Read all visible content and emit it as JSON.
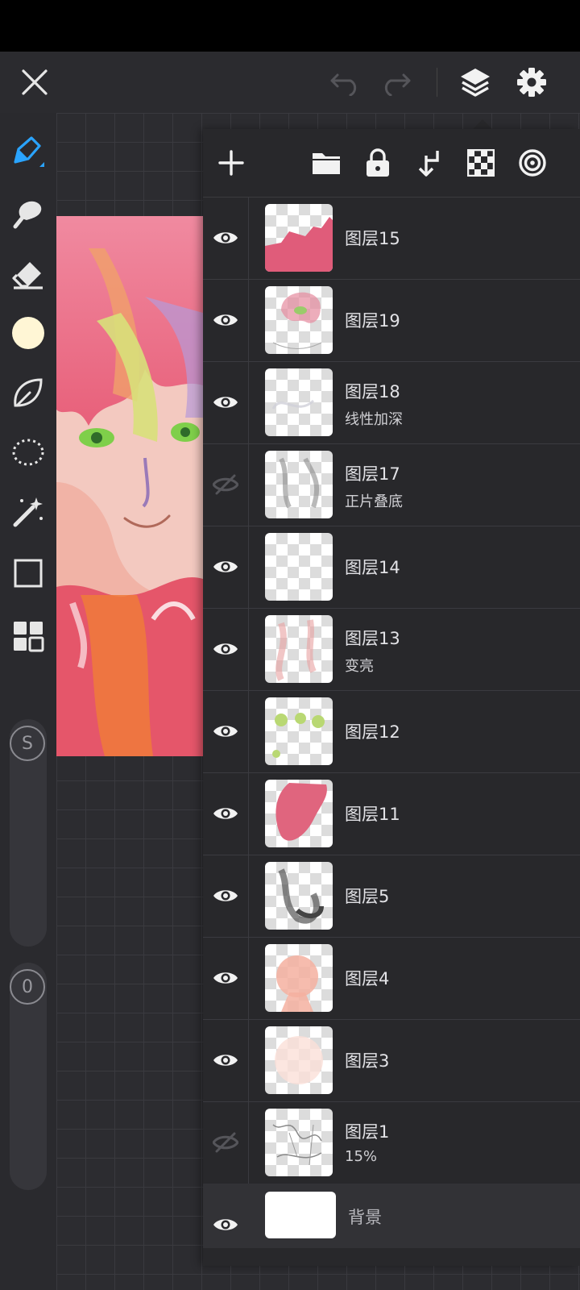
{
  "top_bar": {
    "close_icon": "close-icon",
    "undo_icon": "undo-icon",
    "redo_icon": "redo-icon",
    "layers_icon": "layers-icon",
    "settings_icon": "gear-icon"
  },
  "left_toolbar": {
    "tools": [
      "brush-icon",
      "smudge-icon",
      "eraser-icon",
      "color-swatch",
      "leaf-icon",
      "lasso-icon",
      "magic-wand-icon",
      "rectangle-icon",
      "grid-icon"
    ],
    "current_color": "#fff6d5",
    "size_badge": "S",
    "opacity_badge": "0"
  },
  "layers_panel": {
    "toolbar_icons": [
      "plus-icon",
      "folder-icon",
      "lock-icon",
      "merge-down-icon",
      "checker-icon",
      "target-icon"
    ],
    "layers": [
      {
        "name": "图层15",
        "mode": "",
        "visible": true
      },
      {
        "name": "图层19",
        "mode": "",
        "visible": true
      },
      {
        "name": "图层18",
        "mode": "线性加深",
        "visible": true
      },
      {
        "name": "图层17",
        "mode": "正片叠底",
        "visible": false
      },
      {
        "name": "图层14",
        "mode": "",
        "visible": true
      },
      {
        "name": "图层13",
        "mode": "变亮",
        "visible": true
      },
      {
        "name": "图层12",
        "mode": "",
        "visible": true
      },
      {
        "name": "图层11",
        "mode": "",
        "visible": true
      },
      {
        "name": "图层5",
        "mode": "",
        "visible": true
      },
      {
        "name": "图层4",
        "mode": "",
        "visible": true
      },
      {
        "name": "图层3",
        "mode": "",
        "visible": true
      },
      {
        "name": "图层1",
        "mode": "15%",
        "visible": false
      }
    ],
    "background": {
      "name": "背景",
      "visible": true
    }
  },
  "colors": {
    "accent": "#2aa4ff",
    "panel_bg": "#28282b",
    "toolbar_bg": "#2b2b2f"
  }
}
